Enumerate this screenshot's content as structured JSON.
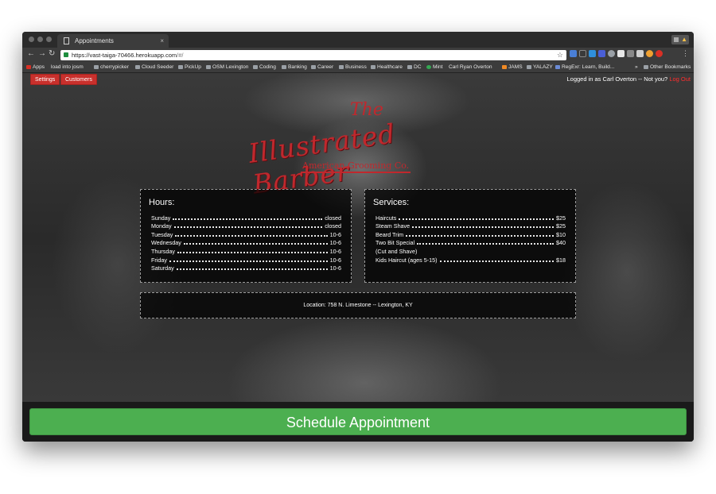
{
  "browser": {
    "tab_title": "Appointments",
    "tab_close": "×",
    "url_host": "https://vast-taiga-70466.herokuapp.com",
    "url_path": "/#/",
    "bookmarks": [
      {
        "label": "Apps",
        "icon": "grid"
      },
      {
        "label": "load into josm",
        "icon": "page"
      },
      {
        "label": "cherrypicker",
        "icon": "folder"
      },
      {
        "label": "Cloud Seeder",
        "icon": "folder"
      },
      {
        "label": "PickUp",
        "icon": "folder"
      },
      {
        "label": "OSM Lexington",
        "icon": "folder"
      },
      {
        "label": "Coding",
        "icon": "folder"
      },
      {
        "label": "Banking",
        "icon": "folder"
      },
      {
        "label": "Career",
        "icon": "folder"
      },
      {
        "label": "Business",
        "icon": "folder"
      },
      {
        "label": "Healthcare",
        "icon": "folder"
      },
      {
        "label": "DC",
        "icon": "folder"
      },
      {
        "label": "Mint",
        "icon": "green"
      },
      {
        "label": "Carl Ryan Overton",
        "icon": "page"
      },
      {
        "label": "JAMS",
        "icon": "orange"
      },
      {
        "label": "YALAZY",
        "icon": "folder"
      },
      {
        "label": "RegExr: Learn, Build...",
        "icon": "dark"
      }
    ],
    "other_bookmarks": "Other Bookmarks",
    "overflow": "»"
  },
  "nav": {
    "settings_label": "Settings",
    "customers_label": "Customers",
    "logged_in_text": "Logged in as Carl Overton -- Not you?",
    "logout_label": "Log Out"
  },
  "logo": {
    "the": "The",
    "main": "Illustrated Barber",
    "sub": "American Grooming Co."
  },
  "hours": {
    "title": "Hours:",
    "rows": [
      {
        "day": "Sunday",
        "value": "closed"
      },
      {
        "day": "Monday",
        "value": "closed"
      },
      {
        "day": "Tuesday",
        "value": "10-6"
      },
      {
        "day": "Wednesday",
        "value": "10-6"
      },
      {
        "day": "Thursday",
        "value": "10-6"
      },
      {
        "day": "Friday",
        "value": "10-6"
      },
      {
        "day": "Saturday",
        "value": "10-6"
      }
    ]
  },
  "services": {
    "title": "Services:",
    "rows": [
      {
        "name": "Haircuts",
        "price": "$25"
      },
      {
        "name": "Steam Shave",
        "price": "$25"
      },
      {
        "name": "Beard Trim",
        "price": "$10"
      },
      {
        "name": "Two Bit Special",
        "price": "$40"
      },
      {
        "name": "(Cut and Shave)",
        "price": ""
      },
      {
        "name": "Kids Haircut (ages 5-15)",
        "price": "$18"
      }
    ]
  },
  "location": "Location: 758 N. Limestone -- Lexington, KY",
  "cta_label": "Schedule Appointment",
  "colors": {
    "brand_red": "#c0282d",
    "button_red": "#c9302c",
    "cta_green": "#4caf50",
    "logout_red": "#ff2d2d"
  }
}
